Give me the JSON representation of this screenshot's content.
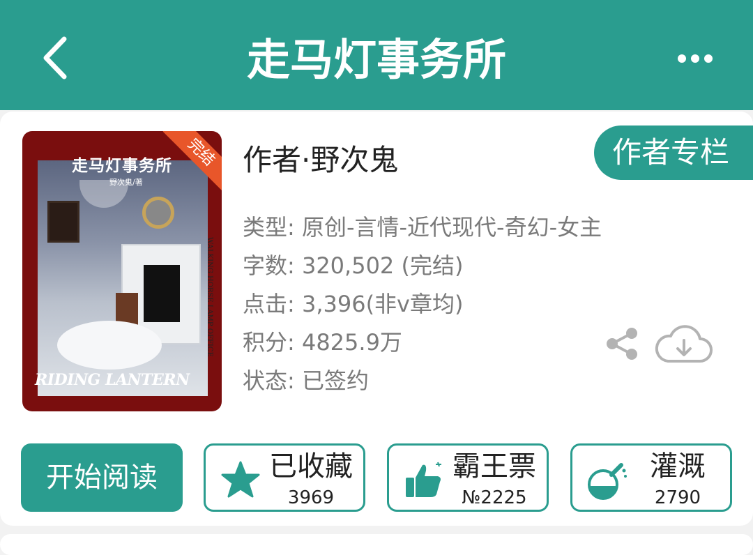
{
  "header": {
    "title": "走马灯事务所",
    "back_icon": "chevron-left-icon",
    "more_icon": "more-horizontal-icon"
  },
  "book": {
    "cover": {
      "title": "走马灯事务所",
      "byline": "野次鬼/著",
      "english_title": "RIDING LANTERN",
      "vertical_text": "WALKING HORSE LAMP OFFICE",
      "status_ribbon": "完结"
    },
    "author": "作者·野次鬼",
    "author_column_button": "作者专栏",
    "info": {
      "type": "类型: 原创-言情-近代现代-奇幻-女主",
      "words": "字数: 320,502 (完结)",
      "clicks": "点击: 3,396(非v章均)",
      "score": "积分: 4825.9万",
      "status": "状态: 已签约"
    }
  },
  "actions": {
    "read_label": "开始阅读",
    "favorite": {
      "label": "已收藏",
      "count": "3969",
      "icon": "star-icon"
    },
    "ticket": {
      "label": "霸王票",
      "count": "№2225",
      "icon": "thumbs-up-icon"
    },
    "nutrient": {
      "label": "灌溉",
      "count": "2790",
      "icon": "flask-icon"
    }
  },
  "colors": {
    "accent": "#2a9d8f",
    "cover_bg": "#7a0e0e",
    "ribbon": "#e8562a",
    "text_gray": "#7a7a7a"
  }
}
